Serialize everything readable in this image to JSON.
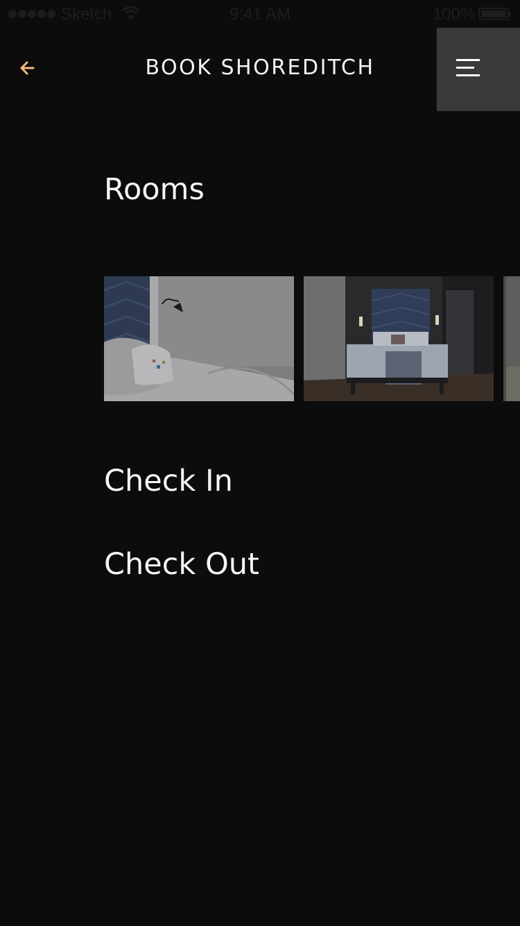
{
  "status_bar": {
    "carrier": "Sketch",
    "time": "9:41 AM",
    "battery": "100%"
  },
  "header": {
    "title": "BOOK SHOREDITCH",
    "back_icon": "arrow-left-icon",
    "menu_icon": "hamburger-menu-icon"
  },
  "sections": {
    "rooms": "Rooms",
    "check_in": "Check In",
    "check_out": "Check Out"
  },
  "colors": {
    "background": "#0c0c0d",
    "accent": "#f5b97a",
    "menu_button": "#3a3a3b",
    "text": "#f4f4f4"
  }
}
